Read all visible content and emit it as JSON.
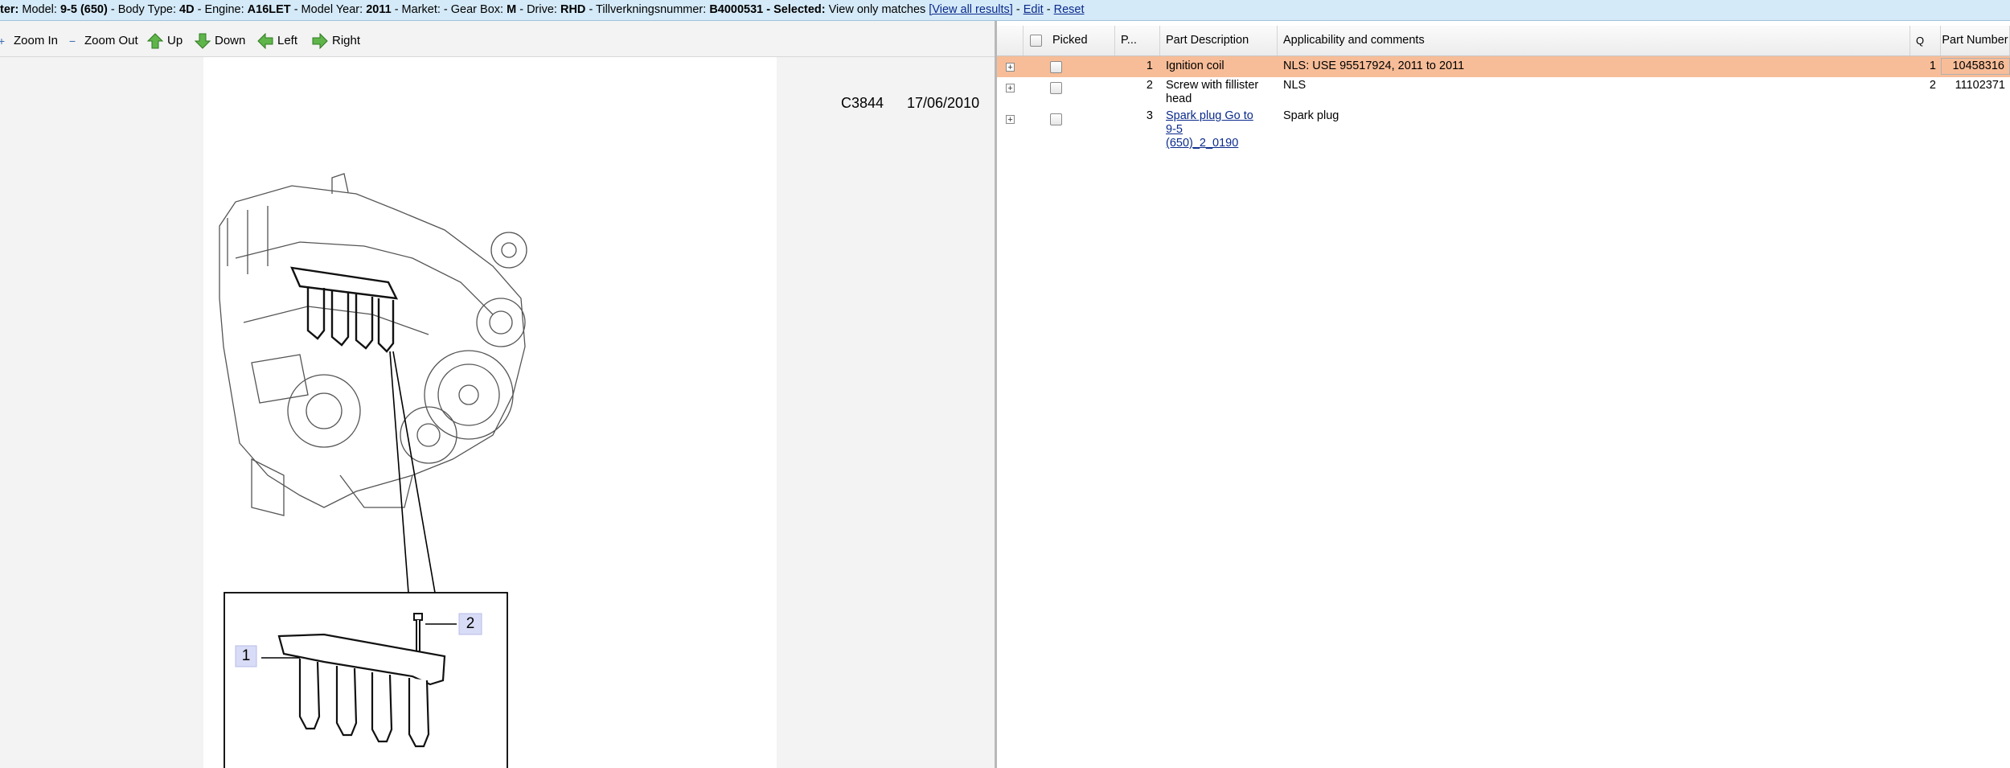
{
  "filter": {
    "prefix": "ter:",
    "model_label": "Model:",
    "model": "9-5 (650)",
    "body_label": "- Body Type:",
    "body": "4D",
    "engine_label": "- Engine:",
    "engine": "A16LET",
    "year_label": "- Model Year:",
    "year": "2011",
    "market_label": "- Market: - Gear Box:",
    "gearbox": "M",
    "drive_label": "- Drive:",
    "drive": "RHD",
    "tillv_label": "- Tillverkningsnummer:",
    "tillv": "B4000531",
    "selected_label": "- Selected:",
    "selected": "View only matches",
    "view_all": "[View all results]",
    "sep1": "-",
    "edit": "Edit",
    "sep2": "-",
    "reset": "Reset"
  },
  "toolbar": {
    "zoom_in": "Zoom In",
    "zoom_out": "Zoom Out",
    "up": "Up",
    "down": "Down",
    "left": "Left",
    "right": "Right"
  },
  "drawing": {
    "code": "C3844",
    "date": "17/06/2010",
    "callout_1": "1",
    "callout_2": "2"
  },
  "grid": {
    "headers": {
      "picked": "Picked",
      "pos": "P...",
      "description": "Part Description",
      "applicability": "Applicability and comments",
      "qty": "Q",
      "part_number": "Part Number"
    },
    "rows": [
      {
        "pos": "1",
        "description": "Ignition coil",
        "applicability": "NLS: USE 95517924, 2011 to 2011",
        "qty": "1",
        "part_number": "10458316"
      },
      {
        "pos": "2",
        "description": "Screw with fillister head",
        "applicability": "NLS",
        "qty": "2",
        "part_number": "11102371"
      },
      {
        "pos": "3",
        "description": "Spark plug Go to 9-5 (650)_2_0190",
        "applicability": "Spark plug",
        "qty": "",
        "part_number": ""
      }
    ]
  },
  "colors": {
    "filter_bg": "#d5eaf8",
    "selected_row": "#f7bd98",
    "link": "#0a2a8c"
  }
}
